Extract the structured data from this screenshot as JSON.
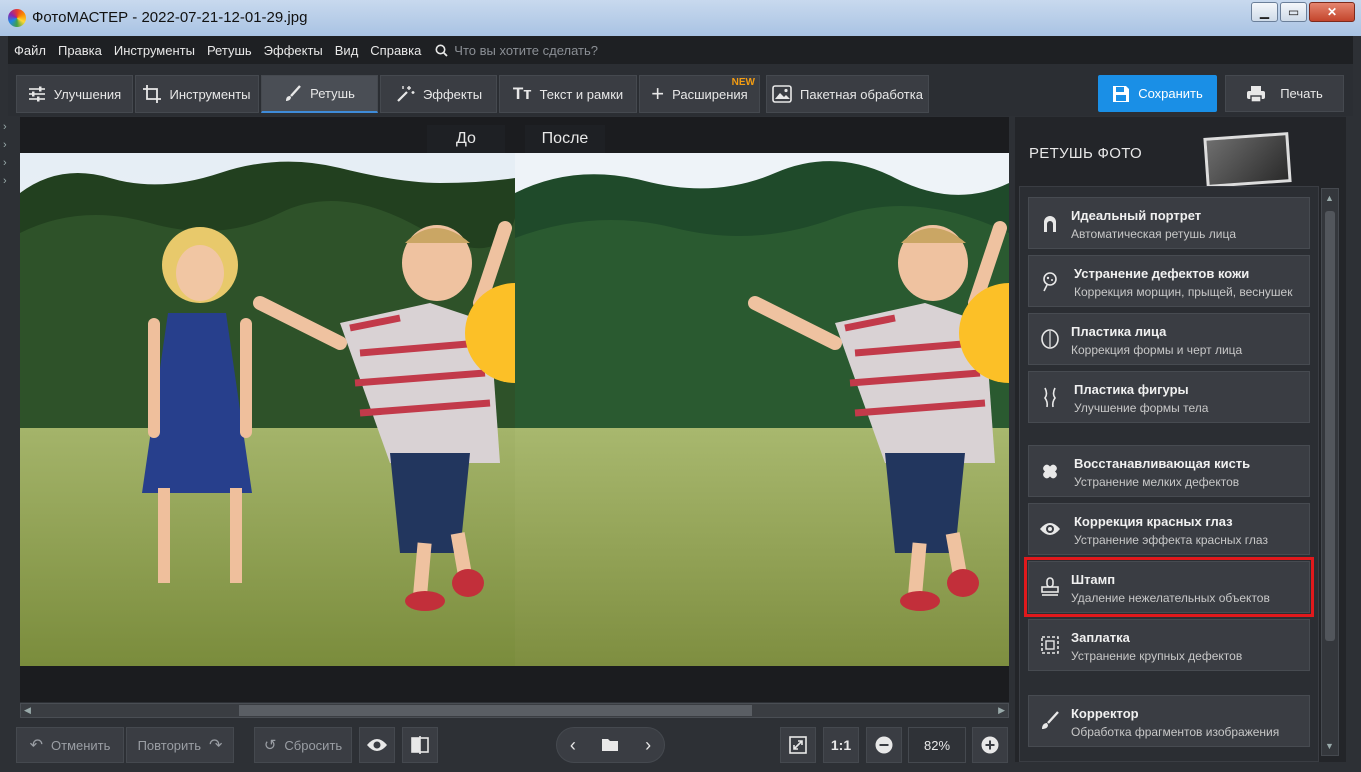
{
  "window": {
    "title": "ФотоМАСТЕР - 2022-07-21-12-01-29.jpg"
  },
  "menu": {
    "items": [
      "Файл",
      "Правка",
      "Инструменты",
      "Ретушь",
      "Эффекты",
      "Вид",
      "Справка"
    ],
    "search_placeholder": "Что вы хотите сделать?"
  },
  "tabs": {
    "enhance": "Улучшения",
    "tools": "Инструменты",
    "retouch": "Ретушь",
    "effects": "Эффекты",
    "text": "Текст и рамки",
    "extensions": "Расширения",
    "extensions_badge": "NEW",
    "batch": "Пакетная обработка"
  },
  "actions": {
    "save": "Сохранить",
    "print": "Печать"
  },
  "preview": {
    "before": "До",
    "after": "После"
  },
  "bottom": {
    "undo": "Отменить",
    "redo": "Повторить",
    "reset": "Сбросить",
    "one_to_one": "1:1",
    "zoom": "82%"
  },
  "panel": {
    "title": "РЕТУШЬ ФОТО",
    "tools": [
      {
        "title": "Идеальный портрет",
        "desc": "Автоматическая ретушь лица",
        "icon": "face-icon"
      },
      {
        "title": "Устранение дефектов кожи",
        "desc": "Коррекция морщин, прыщей, веснушек",
        "icon": "skin-icon"
      },
      {
        "title": "Пластика лица",
        "desc": "Коррекция формы и черт лица",
        "icon": "face-shape-icon"
      },
      {
        "title": "Пластика фигуры",
        "desc": "Улучшение формы тела",
        "icon": "body-icon"
      },
      {
        "title": "Восстанавливающая кисть",
        "desc": "Устранение мелких дефектов",
        "icon": "bandage-icon"
      },
      {
        "title": "Коррекция красных глаз",
        "desc": "Устранение эффекта красных глаз",
        "icon": "eye-icon"
      },
      {
        "title": "Штамп",
        "desc": "Удаление нежелательных объектов",
        "icon": "stamp-icon"
      },
      {
        "title": "Заплатка",
        "desc": "Устранение крупных дефектов",
        "icon": "patch-icon"
      },
      {
        "title": "Корректор",
        "desc": "Обработка фрагментов изображения",
        "icon": "brush-icon"
      }
    ]
  },
  "colors": {
    "accent": "#1a8fe6",
    "highlight": "#e0191c",
    "new_badge": "#f39c12"
  }
}
